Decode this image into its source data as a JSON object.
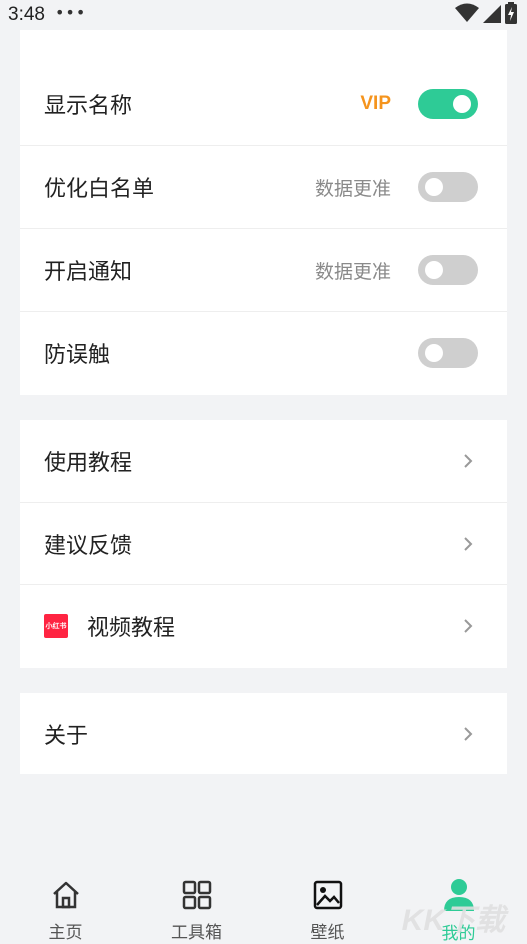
{
  "status": {
    "time": "3:48",
    "dots": "•••"
  },
  "settings_toggles": [
    {
      "label": "显示名称",
      "hint": "VIP",
      "hint_style": "vip",
      "on": true
    },
    {
      "label": "优化白名单",
      "hint": "数据更准",
      "hint_style": "muted",
      "on": false
    },
    {
      "label": "开启通知",
      "hint": "数据更准",
      "hint_style": "muted",
      "on": false
    },
    {
      "label": "防误触",
      "hint": "",
      "hint_style": "muted",
      "on": false
    }
  ],
  "links": [
    {
      "label": "使用教程",
      "icon": "chevron-right-icon"
    },
    {
      "label": "建议反馈",
      "icon": "chevron-right-icon"
    },
    {
      "label": "视频教程",
      "icon": "chevron-right-icon",
      "logo_text": "小红书"
    }
  ],
  "about": {
    "label": "关于"
  },
  "tabbar": {
    "items": [
      {
        "label": "主页",
        "icon": "home-icon",
        "active": false
      },
      {
        "label": "工具箱",
        "icon": "grid-icon",
        "active": false
      },
      {
        "label": "壁纸",
        "icon": "image-icon",
        "active": false
      },
      {
        "label": "我的",
        "icon": "person-icon",
        "active": true
      }
    ]
  },
  "watermark": "KK下载",
  "colors": {
    "accent": "#2ecb96",
    "vip": "#f5941d",
    "toggle_off": "#cfcfcf",
    "background": "#f2f3f5"
  }
}
